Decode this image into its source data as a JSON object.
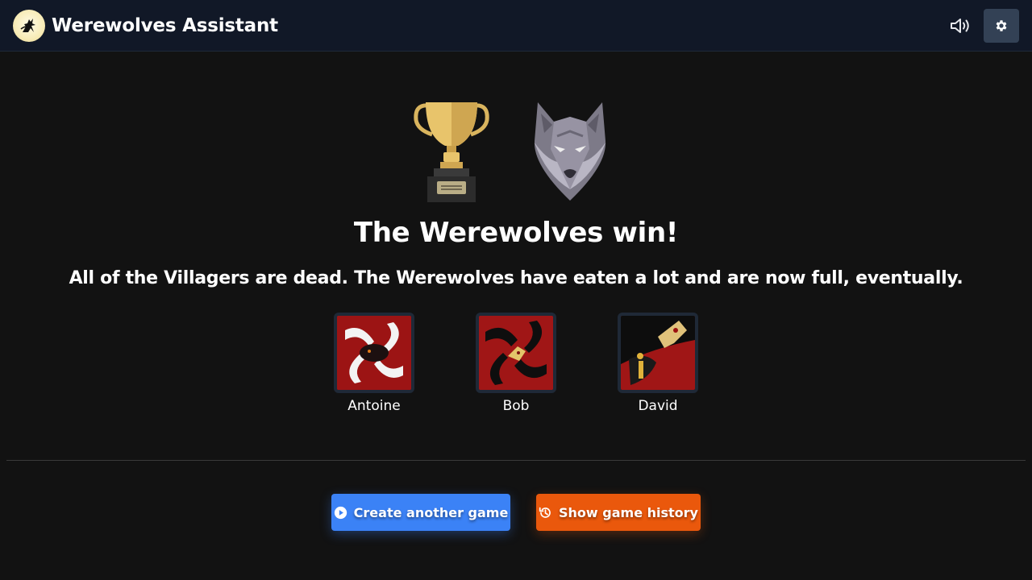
{
  "header": {
    "app_title": "Werewolves Assistant",
    "logo_icon": "werewolf-howl-icon",
    "sound_icon": "speaker-volume-icon",
    "settings_icon": "gear-icon"
  },
  "result": {
    "icons": [
      "trophy-icon",
      "werewolf-icon"
    ],
    "title": "The Werewolves win!",
    "message": "All of the Villagers are dead. The Werewolves have eaten a lot and are now full, eventually."
  },
  "winners": [
    {
      "name": "Antoine",
      "role_icon": "white-werewolf-card"
    },
    {
      "name": "Bob",
      "role_icon": "werewolf-card"
    },
    {
      "name": "David",
      "role_icon": "big-bad-wolf-card"
    }
  ],
  "actions": {
    "create_label": "Create another game",
    "create_icon": "play-circle-icon",
    "history_label": "Show game history",
    "history_icon": "history-icon"
  },
  "colors": {
    "background": "#121212",
    "header": "#111827",
    "primary": "#3b82f6",
    "warning": "#ea580c",
    "card_red": "#8b1212"
  }
}
